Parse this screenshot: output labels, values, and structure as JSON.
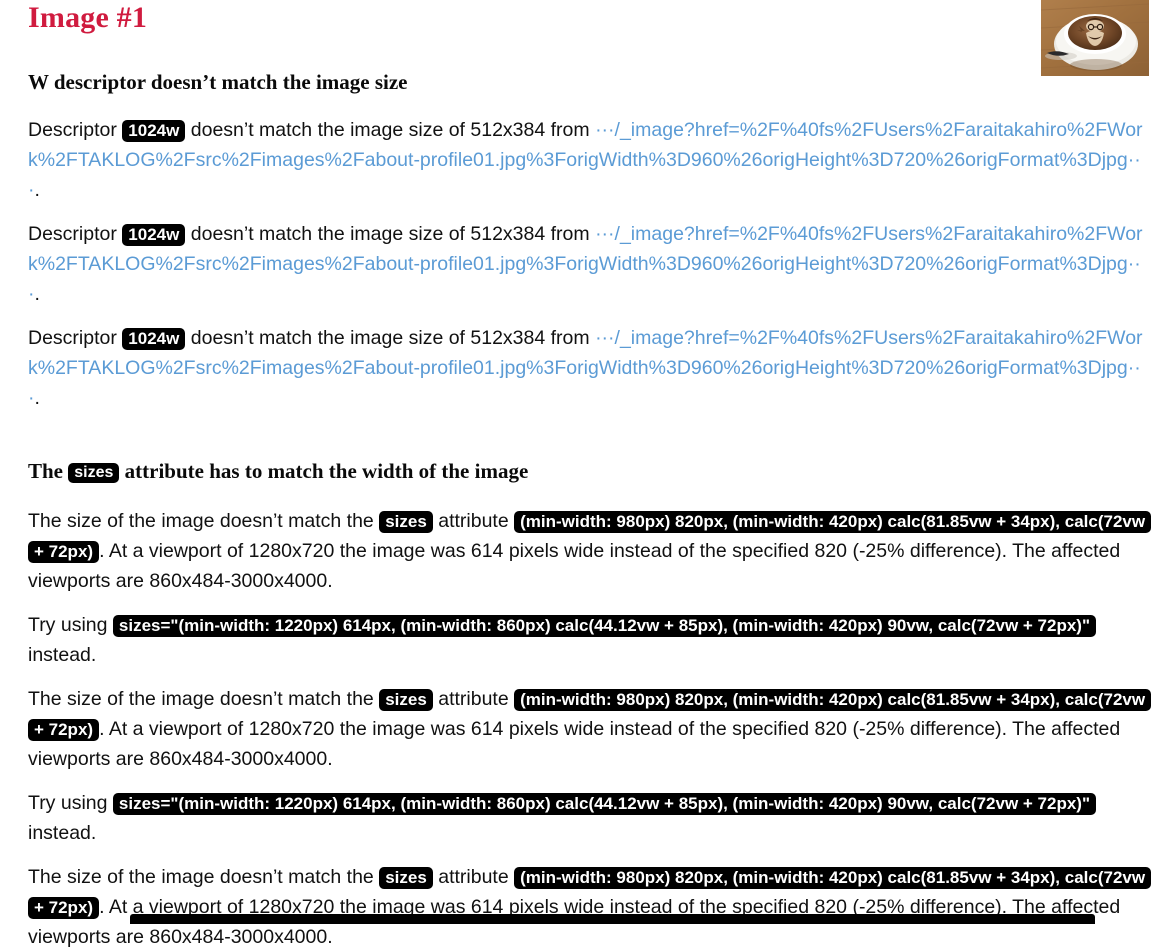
{
  "report": {
    "title": "Image #1",
    "thumbnail_alt": "latte-art-coffee-cup-thumbnail"
  },
  "colors": {
    "title": "#d01b3f",
    "link": "#5b9bd5",
    "badge_bg": "#000000",
    "badge_text": "#ffffff",
    "text": "#111111"
  },
  "sections": [
    {
      "heading_prefix": "W descriptor doesn’t match the image size",
      "heading_badge": "",
      "heading_suffix": "",
      "messages": [
        {
          "lead": "Descriptor",
          "badge": "1024w",
          "mid": "doesn’t match the image size of 512x384 from",
          "link": "···/_image?href=%2F%40fs%2FUsers%2Faraitakahiro%2FWork%2FTAKLOG%2Fsrc%2Fimages%2Fabout-profile01.jpg%3ForigWidth%3D960%26origHeight%3D720%26origFormat%3Djpg···",
          "tail": "."
        },
        {
          "lead": "Descriptor",
          "badge": "1024w",
          "mid": "doesn’t match the image size of 512x384 from",
          "link": "···/_image?href=%2F%40fs%2FUsers%2Faraitakahiro%2FWork%2FTAKLOG%2Fsrc%2Fimages%2Fabout-profile01.jpg%3ForigWidth%3D960%26origHeight%3D720%26origFormat%3Djpg···",
          "tail": "."
        },
        {
          "lead": "Descriptor",
          "badge": "1024w",
          "mid": "doesn’t match the image size of 512x384 from",
          "link": "···/_image?href=%2F%40fs%2FUsers%2Faraitakahiro%2FWork%2FTAKLOG%2Fsrc%2Fimages%2Fabout-profile01.jpg%3ForigWidth%3D960%26origHeight%3D720%26origFormat%3Djpg···",
          "tail": "."
        }
      ]
    },
    {
      "heading_prefix": "The",
      "heading_badge": "sizes",
      "heading_suffix": "attribute has to match the width of the image",
      "messages": []
    }
  ],
  "sizes_messages": [
    {
      "kind": "mismatch",
      "lead": "The size of the image doesn’t match the",
      "badge1": "sizes",
      "mid": "attribute",
      "badge2": "(min-width: 980px) 820px, (min-width: 420px) calc(81.85vw + 34px), calc(72vw + 72px)",
      "tail": ". At a viewport of 1280x720 the image was 614 pixels wide instead of the specified 820 (-25% difference). The affected viewports are 860x484-3000x4000."
    },
    {
      "kind": "suggestion",
      "lead": "Try using",
      "badge1": "sizes=\"(min-width: 1220px) 614px, (min-width: 860px) calc(44.12vw + 85px), (min-width: 420px) 90vw, calc(72vw + 72px)\"",
      "tail": "instead."
    },
    {
      "kind": "mismatch",
      "lead": "The size of the image doesn’t match the",
      "badge1": "sizes",
      "mid": "attribute",
      "badge2": "(min-width: 980px) 820px, (min-width: 420px) calc(81.85vw + 34px), calc(72vw + 72px)",
      "tail": ". At a viewport of 1280x720 the image was 614 pixels wide instead of the specified 820 (-25% difference). The affected viewports are 860x484-3000x4000."
    },
    {
      "kind": "suggestion",
      "lead": "Try using",
      "badge1": "sizes=\"(min-width: 1220px) 614px, (min-width: 860px) calc(44.12vw + 85px), (min-width: 420px) 90vw, calc(72vw + 72px)\"",
      "tail": "instead."
    },
    {
      "kind": "mismatch",
      "lead": "The size of the image doesn’t match the",
      "badge1": "sizes",
      "mid": "attribute",
      "badge2": "(min-width: 980px) 820px, (min-width: 420px) calc(81.85vw + 34px), calc(72vw + 72px)",
      "tail": ". At a viewport of 1280x720 the image was 614 pixels wide instead of the specified 820 (-25% difference). The affected viewports are 860x484-3000x4000."
    }
  ]
}
